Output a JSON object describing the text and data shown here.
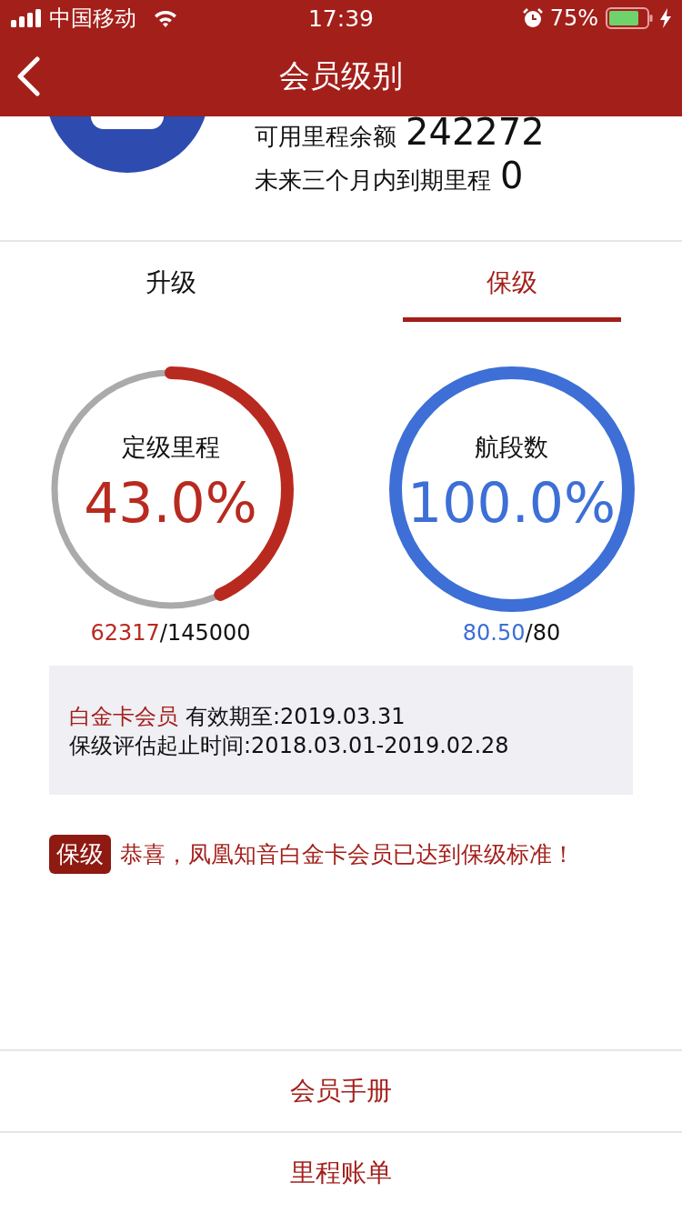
{
  "status_bar": {
    "carrier": "中国移动",
    "time": "17:39",
    "battery": "75%"
  },
  "nav": {
    "title": "会员级别"
  },
  "account": {
    "rows": [
      {
        "label": "可用里程余额",
        "value": "242272"
      },
      {
        "label": "未来三个月内到期里程",
        "value": "0"
      }
    ]
  },
  "tabs": [
    {
      "label": "升级",
      "selected": false
    },
    {
      "label": "保级",
      "selected": true
    }
  ],
  "gauges": [
    {
      "title": "定级里程",
      "percent": "43.0%",
      "level": 0.43,
      "color": "#b82a1f",
      "current": "62317",
      "target": "/145000"
    },
    {
      "title": "航段数",
      "percent": "100.0%",
      "level": 1,
      "color": "#3d6fd6",
      "current": "80.50",
      "target": "/80"
    }
  ],
  "info": {
    "tier": "白金卡会员",
    "validity": "有效期至:2019.03.31",
    "period": "保级评估起止时间:2018.03.01-2019.02.28"
  },
  "notice": {
    "badge": "保级",
    "message": "恭喜，凤凰知音白金卡会员已达到保级标准！"
  },
  "links": [
    "会员手册",
    "里程账单"
  ]
}
